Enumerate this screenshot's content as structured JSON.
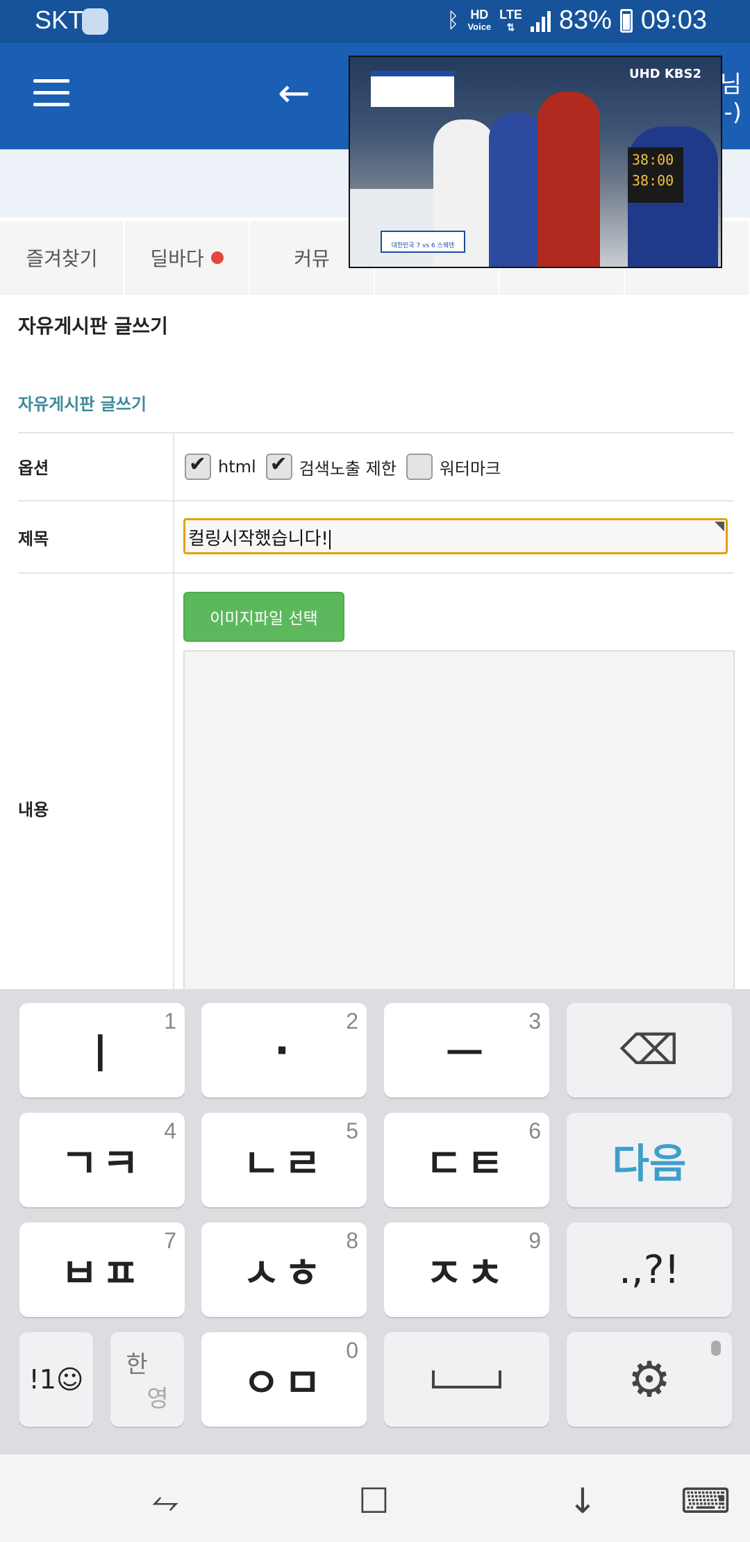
{
  "status_bar": {
    "carrier": "SKT",
    "hd_label": "HD",
    "voice_label": "Voice",
    "lte_label": "LTE",
    "battery": "83%",
    "time": "09:03"
  },
  "header": {
    "edge_text_1": "님",
    "edge_text_2": "-)"
  },
  "tabs": [
    {
      "label": "즐겨찾기",
      "has_dot": false
    },
    {
      "label": "딜바다",
      "has_dot": true
    },
    {
      "label": "커뮤",
      "has_dot": false
    }
  ],
  "video": {
    "logo": "UHD KBS2",
    "score_top": "38:00",
    "score_bottom": "38:00",
    "caption_bottom": "대한민국 7 vs 6 스웨덴"
  },
  "page": {
    "title": "자유게시판 글쓰기",
    "section_title": "자유게시판 글쓰기"
  },
  "form": {
    "options_label": "옵션",
    "options": [
      {
        "label": "html",
        "checked": true
      },
      {
        "label": "검색노출 제한",
        "checked": true
      },
      {
        "label": "워터마크",
        "checked": false
      }
    ],
    "subject_label": "제목",
    "subject_value": "컬링시작했습니다!",
    "content_label": "내용",
    "upload_button": "이미지파일 선택"
  },
  "keyboard": {
    "row1": [
      {
        "glyph": "ㅣ",
        "num": "1"
      },
      {
        "glyph": "·",
        "num": "2"
      },
      {
        "glyph": "ㅡ",
        "num": "3"
      }
    ],
    "row2": [
      {
        "glyph": "ㄱㅋ",
        "num": "4"
      },
      {
        "glyph": "ㄴㄹ",
        "num": "5"
      },
      {
        "glyph": "ㄷㅌ",
        "num": "6"
      }
    ],
    "row3": [
      {
        "glyph": "ㅂㅍ",
        "num": "7"
      },
      {
        "glyph": "ㅅㅎ",
        "num": "8"
      },
      {
        "glyph": "ㅈㅊ",
        "num": "9"
      }
    ],
    "next_label": "다음",
    "punct_label": ".,?!",
    "symbols_label": "!1☺",
    "lang_top": "한",
    "lang_bottom": "영",
    "zero_glyph": "ㅇㅁ",
    "zero_num": "0"
  },
  "icons": {
    "backspace": "backspace-icon",
    "space": "space-bar-icon",
    "settings": "gear-icon",
    "mic": "mic-icon"
  },
  "colors": {
    "status_bar": "#16539a",
    "app_bar": "#1a5fb4",
    "accent_green": "#5cb85c",
    "input_focus": "#e3a000",
    "next_key": "#3f9fc9"
  }
}
